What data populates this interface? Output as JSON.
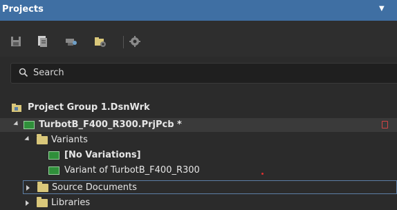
{
  "panel": {
    "title": "Projects",
    "menu_glyph": "▼"
  },
  "toolbar": {
    "buttons": [
      {
        "icon": "save-icon"
      },
      {
        "icon": "save-all-icon"
      },
      {
        "icon": "compile-icon"
      },
      {
        "icon": "open-folder-icon"
      },
      {
        "icon": "gear-icon"
      }
    ]
  },
  "search": {
    "placeholder": "Search"
  },
  "tree": {
    "items": [
      {
        "label": "Project Group 1.DsnWrk",
        "icon": "project-group-icon"
      },
      {
        "label": "TurbotB_F400_R300.PrjPcb *",
        "icon": "pcb-project-icon"
      },
      {
        "label": "Variants",
        "icon": "folder-icon"
      },
      {
        "label": "[No Variations]",
        "icon": "variant-icon"
      },
      {
        "label": "Variant of TurbotB_F400_R300",
        "icon": "variant-icon"
      },
      {
        "label": "Source Documents",
        "icon": "folder-icon"
      },
      {
        "label": "Libraries",
        "icon": "folder-icon"
      }
    ]
  },
  "colors": {
    "titlebar": "#3f6fa3",
    "background": "#2b2b2b",
    "modified_marker": "#d64545"
  }
}
